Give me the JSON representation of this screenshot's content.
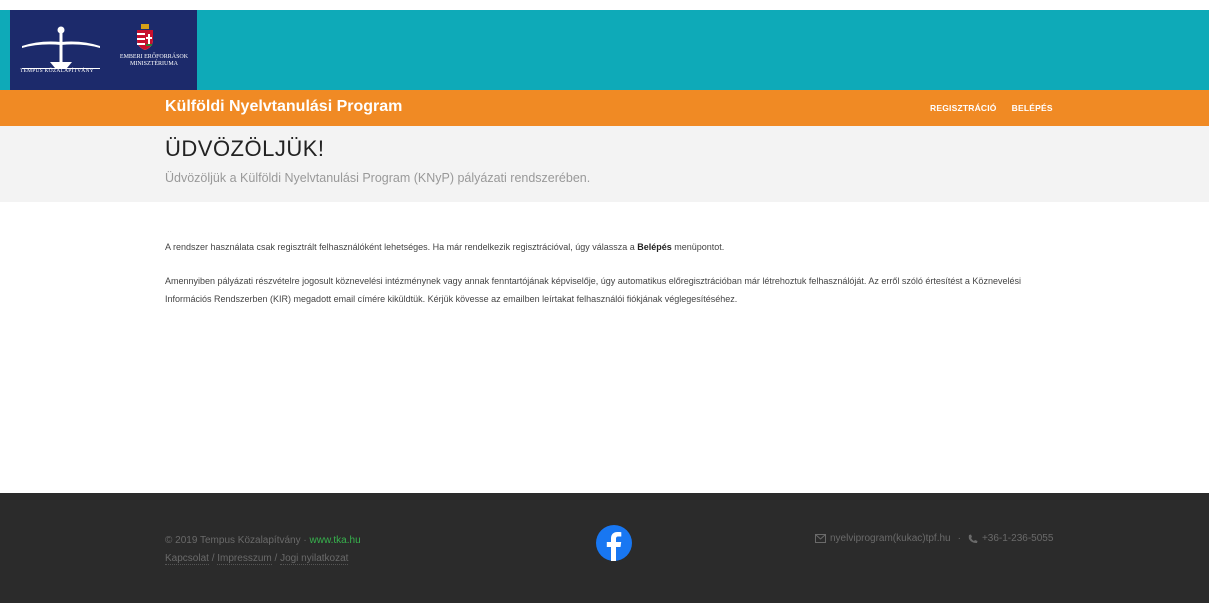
{
  "header": {
    "tempus_logo_text": "TEMPUS KÖZALAPÍTVÁNY",
    "ministry_line1": "EMBERI ERŐFORRÁSOK",
    "ministry_line2": "MINISZTÉRIUMA",
    "brand_color": "#0eaab8",
    "logo_bg_color": "#1c2a6b"
  },
  "navbar": {
    "title": "Külföldi Nyelvtanulási Program",
    "accent_color": "#f08a24",
    "items": [
      {
        "label": "REGISZTRÁCIÓ"
      },
      {
        "label": "BELÉPÉS"
      }
    ]
  },
  "hero": {
    "title": "ÜDVÖZÖLJÜK!",
    "subtitle": "Üdvözöljük a Külföldi Nyelvtanulási Program (KNyP) pályázati rendszerében."
  },
  "content": {
    "p1_before": "A rendszer használata csak regisztrált felhasználóként lehetséges. Ha már rendelkezik regisztrációval, úgy válassza a ",
    "p1_bold": "Belépés",
    "p1_after": " menüpontot.",
    "p2": "Amennyiben pályázati részvételre jogosult köznevelési intézménynek vagy annak fenntartójának képviselője, úgy automatikus előregisztrációban már létrehoztuk felhasználóját. Az erről szóló értesítést a Köznevelési Információs Rendszerben (KIR) megadott email címére kiküldtük. Kérjük kövesse az emailben leírtakat felhasználói fiókjának véglegesítéséhez."
  },
  "footer": {
    "copyright": "© 2019 Tempus Közalapítvány · ",
    "site_link": "www.tka.hu",
    "links": [
      {
        "label": "Kapcsolat"
      },
      {
        "label": "Impresszum"
      },
      {
        "label": "Jogi nyilatkozat"
      }
    ],
    "separator": " / ",
    "email": "nyelviprogram(kukac)tpf.hu",
    "dot": "·",
    "phone": "+36-1-236-5055",
    "icons": {
      "social": "facebook-icon",
      "email": "envelope-icon",
      "phone": "phone-icon"
    }
  }
}
